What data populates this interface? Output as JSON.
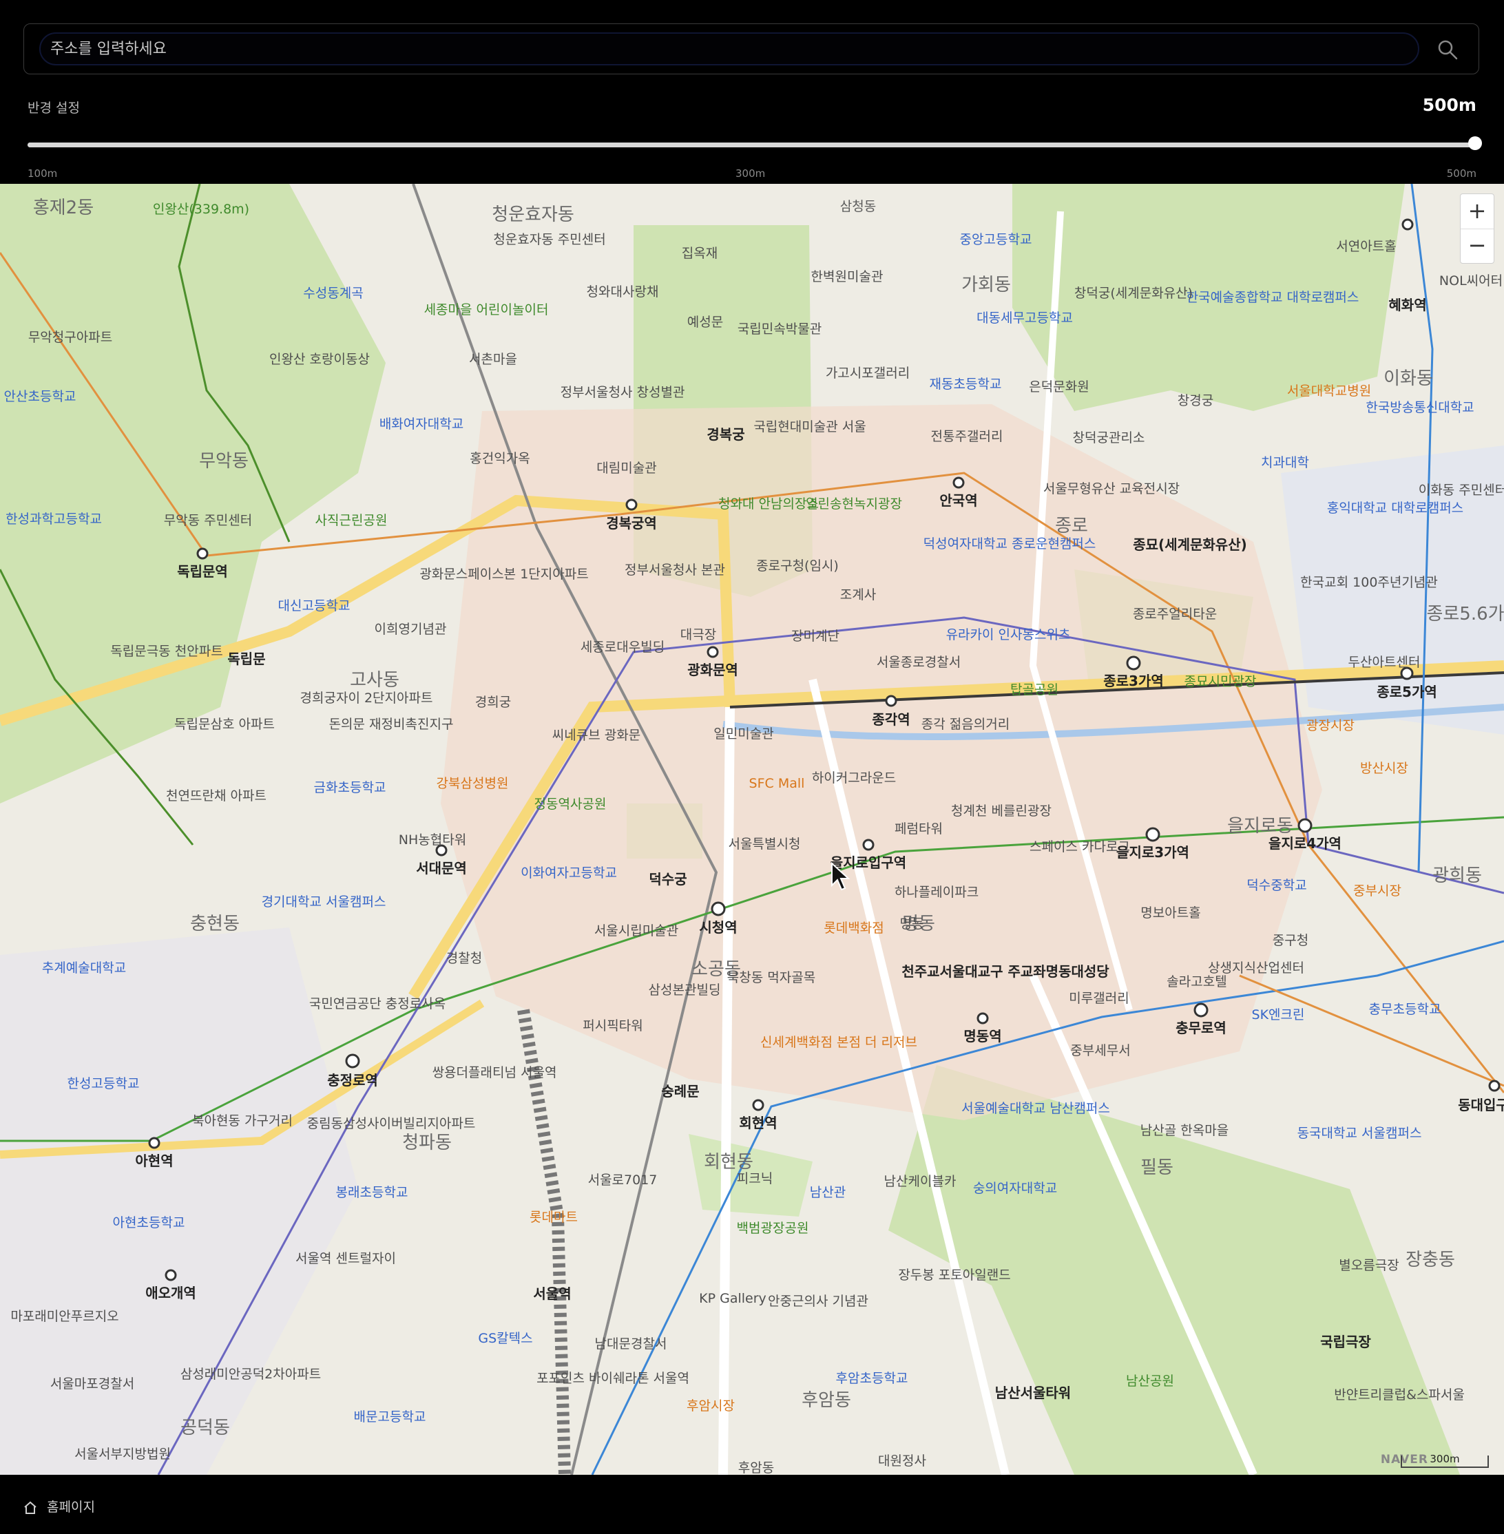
{
  "search": {
    "placeholder": "주소를 입력하세요"
  },
  "radius": {
    "label": "반경 설정",
    "value_text": "500m",
    "value_m": 500,
    "min_m": 100,
    "max_m": 500,
    "ticks": [
      "100m",
      "300m",
      "500m"
    ]
  },
  "map": {
    "brand": "NAVER",
    "scale_label": "300m",
    "zoom_in": "+",
    "zoom_out": "−",
    "districts": [
      "홍제2동",
      "청운효자동",
      "삼청동",
      "가회동",
      "무악동",
      "이화동",
      "종로",
      "종로5.6가",
      "고사동",
      "을지로동",
      "광희동",
      "충현동",
      "소공동",
      "명동",
      "필동",
      "장충동",
      "회현동",
      "후암동",
      "공덕동",
      "청파동"
    ],
    "stations": [
      "경복궁역",
      "안국역",
      "광화문역",
      "종각역",
      "종로3가역",
      "종로5가역",
      "을지로입구역",
      "을지로3가역",
      "을지로4가역",
      "시청역",
      "서대문역",
      "독립문역",
      "충정로역",
      "아현역",
      "애오개역",
      "명동역",
      "충무로역",
      "회현역",
      "서울역",
      "혜화역",
      "동대입구"
    ],
    "pois_blue": [
      "수성동계곡",
      "안산초등학교",
      "배화여자대학교",
      "한성과학고등학교",
      "대신고등학교",
      "이화여자고등학교",
      "금화초등학교",
      "경기대학교 서울캠퍼스",
      "추계예술대학교",
      "한성고등학교",
      "봉래초등학교",
      "아현초등학교",
      "배문고등학교",
      "서울예술대학교 남산캠퍼스",
      "숭의여자대학교",
      "남산관",
      "덕수중학교",
      "충무초등학교",
      "동국대학교 서울캠퍼스",
      "SK엔크린",
      "중앙고등학교",
      "대동세무고등학교",
      "재동초등학교",
      "덕성여자대학교 종로운현캠퍼스",
      "한국예술종합학교 대학로캠퍼스",
      "한국방송통신대학교",
      "홍익대학교 대학로캠퍼스",
      "치과대학",
      "정부서울청사 창성별관",
      "정부서울청사 본관",
      "세종로대우빌딩",
      "종로구청(임시)",
      "서울종로경찰서",
      "서울특별시청",
      "삼성본관빌딩",
      "국민연금공단 충정로사옥",
      "경찰청",
      "남대문경찰서",
      "후암초등학교",
      "서울마포경찰서",
      "상생지식산업센터",
      "중부세무서",
      "페럼타워",
      "서울시립미술관",
      "퍼시픽타워",
      "중구청"
    ],
    "pois_green": [
      "인왕산(339.8m)",
      "세종마을 어린이놀이터",
      "사직근린공원",
      "청와대 안남의장소",
      "열린송현녹지광장",
      "탑골공원",
      "종묘시민광장",
      "정동역사공원",
      "백범광장공원",
      "남산공원"
    ],
    "pois_orange": [
      "강북삼성병원",
      "SFC Mall",
      "롯데백화점",
      "신세계백화점 본점 더 리저브",
      "롯데마트",
      "후암시장",
      "광장시장",
      "방산시장",
      "중부시장",
      "서울대학교병원"
    ],
    "pois_gray": [
      "경복궁",
      "덕수궁",
      "숭례문",
      "종묘(세계문화유산)",
      "독립문",
      "천주교서울대교구 주교좌명동대성당",
      "남산서울타워",
      "국립극장",
      "국립현대미술관 서울",
      "대림미술관",
      "창덕궁(세계문화유산)",
      "창경궁",
      "대극장",
      "일민미술관",
      "청계천 베를린광장",
      "하나플레이파크",
      "명보아트홀",
      "남산케이블카",
      "남산골 한옥마을",
      "KP Gallery",
      "안중근의사 기념관",
      "서울역 센트럴자이",
      "씨네큐브 광화문",
      "경희궁",
      "청와대사랑채",
      "국립민속박물관",
      "한벽원미술관",
      "가고시포갤러리",
      "은덕문화원",
      "창덕궁관리소",
      "전통주갤러리",
      "조계사",
      "장미계단",
      "하이커그라운드",
      "스페이스 카다로그",
      "미루갤러리",
      "피크닉",
      "서울로7017",
      "쌍용더플래티넘 서울역",
      "중림동삼성사이버빌리지아파트",
      "북아현동 가구거리",
      "마포래미안푸르지오",
      "삼성래미안공덕2차아파트",
      "서울서부지방법원",
      "한국교회 100주년기념관",
      "두산아트센터",
      "서연아트홀",
      "종로주얼리타운",
      "서울무형유산 교육전시장",
      "유라카이 인사동스위츠",
      "종각 젊음의거리",
      "경희궁자이 2단지아파트",
      "돈의문 재정비촉진지구",
      "광화문스페이스본 1단지아파트",
      "이희영기념관",
      "독립문극동 천안파트",
      "독립문삼호 아파트",
      "천연뜨란채 아파트",
      "무악동 주민센터",
      "무악청구아파트",
      "인왕산 호랑이동상",
      "홍건익가옥",
      "예성문",
      "집옥재",
      "서촌마을",
      "청운효자동 주민센터",
      "NH농협타워",
      "북창동 먹자골목",
      "명동",
      "솔라고호텔",
      "장두봉 포토아일랜드",
      "포포인츠 바이쉐라톤 서울역",
      "GS칼텍스",
      "대원정사",
      "후암동",
      "NOL씨어터",
      "이화동 주민센터",
      "반얀트리클럽&스파서울",
      "별오름극장"
    ]
  },
  "footer": {
    "label": "홈페이지"
  }
}
